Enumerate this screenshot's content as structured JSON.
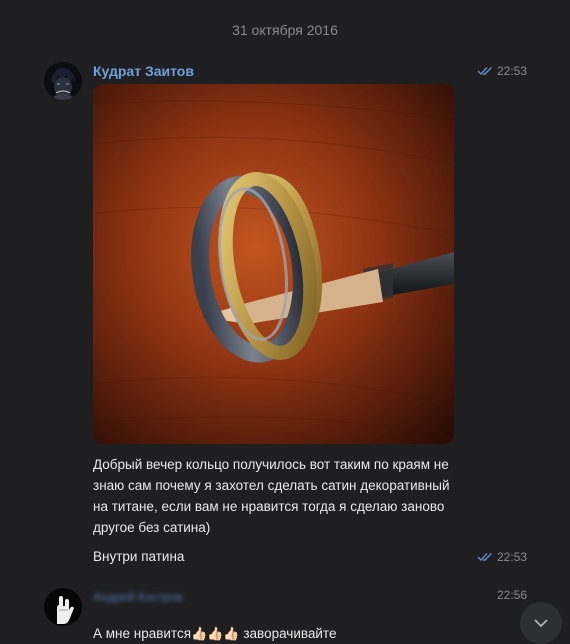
{
  "date_separator": "31 октября 2016",
  "messages": [
    {
      "author": "Кудрат Заитов",
      "time": "22:53",
      "photo_icon": "photo-of-ring-on-pencil",
      "text": "Добрый вечер кольцо получилось вот таким по краям не\nзнаю сам почему я захотел сделать сатин декоративный\nна титане, если вам не нравится тогда я сделаю заново\nдругое без сатина)",
      "status": "read"
    },
    {
      "author": "",
      "time": "22:53",
      "text": "Внутри патина",
      "status": "read"
    },
    {
      "author": "Андрей Костров",
      "time": "22:56",
      "text": "А мне нравится",
      "emoji": "👍🏻👍🏻👍🏻",
      "text_after": " заворачивайте"
    }
  ],
  "colors": {
    "background": "#1f1f21",
    "author_name": "#6ea0d9",
    "read_check": "#5f8fcf",
    "muted": "#8a8a8e"
  }
}
